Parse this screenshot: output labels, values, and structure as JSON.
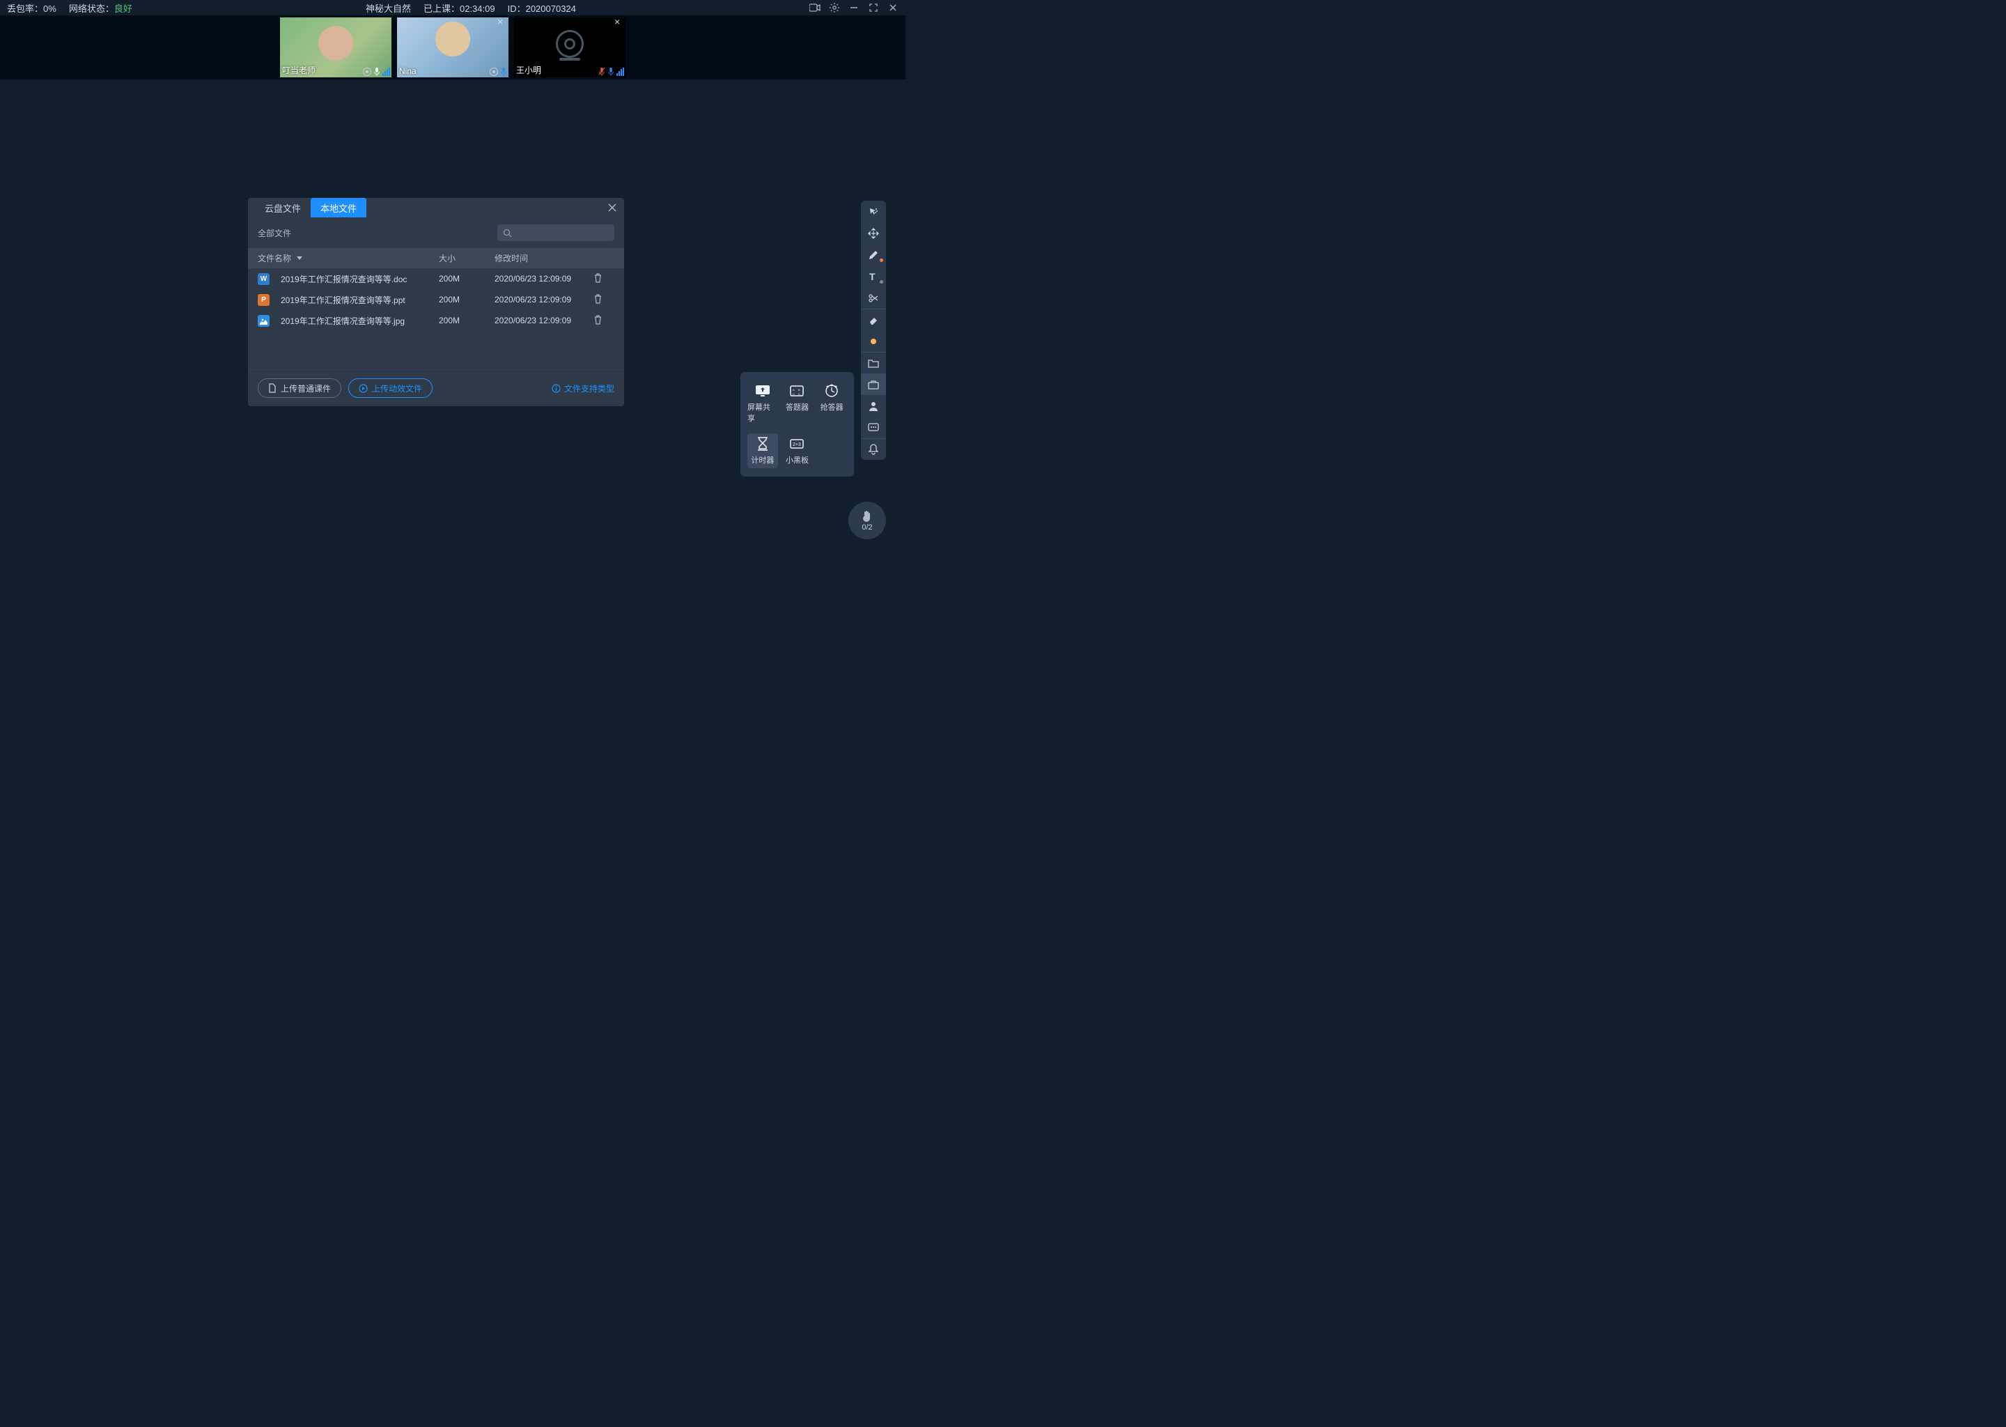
{
  "status_bar": {
    "packet_loss_label": "丢包率：",
    "packet_loss_value": "0%",
    "network_label": "网络状态：",
    "network_value": "良好",
    "title": "神秘大自然",
    "elapsed_label": "已上课：",
    "elapsed_value": "02:34:09",
    "id_label": "ID：",
    "id_value": "2020070324"
  },
  "participants": [
    {
      "name": "叮当老师"
    },
    {
      "name": "Nina"
    },
    {
      "name": "王小明"
    }
  ],
  "tools_popup": {
    "screen_share": "屏幕共享",
    "answer": "答题器",
    "buzzer": "抢答器",
    "timer": "计时器",
    "blackboard": "小黑板"
  },
  "hand": {
    "count": "0/2"
  },
  "dialog": {
    "tab_cloud": "云盘文件",
    "tab_local": "本地文件",
    "all_files": "全部文件",
    "col_name": "文件名称",
    "col_size": "大小",
    "col_time": "修改时间",
    "rows": [
      {
        "icon": "W",
        "cls": "bluei",
        "name": "2019年工作汇报情况查询等等.doc",
        "size": "200M",
        "time": "2020/06/23 12:09:09"
      },
      {
        "icon": "P",
        "cls": "orangei",
        "name": "2019年工作汇报情况查询等等.ppt",
        "size": "200M",
        "time": "2020/06/23 12:09:09"
      },
      {
        "icon": "",
        "cls": "imgi",
        "name": "2019年工作汇报情况查询等等.jpg",
        "size": "200M",
        "time": "2020/06/23 12:09:09"
      }
    ],
    "upload_normal": "上传普通课件",
    "upload_dynamic": "上传动效文件",
    "support": "文件支持类型"
  }
}
